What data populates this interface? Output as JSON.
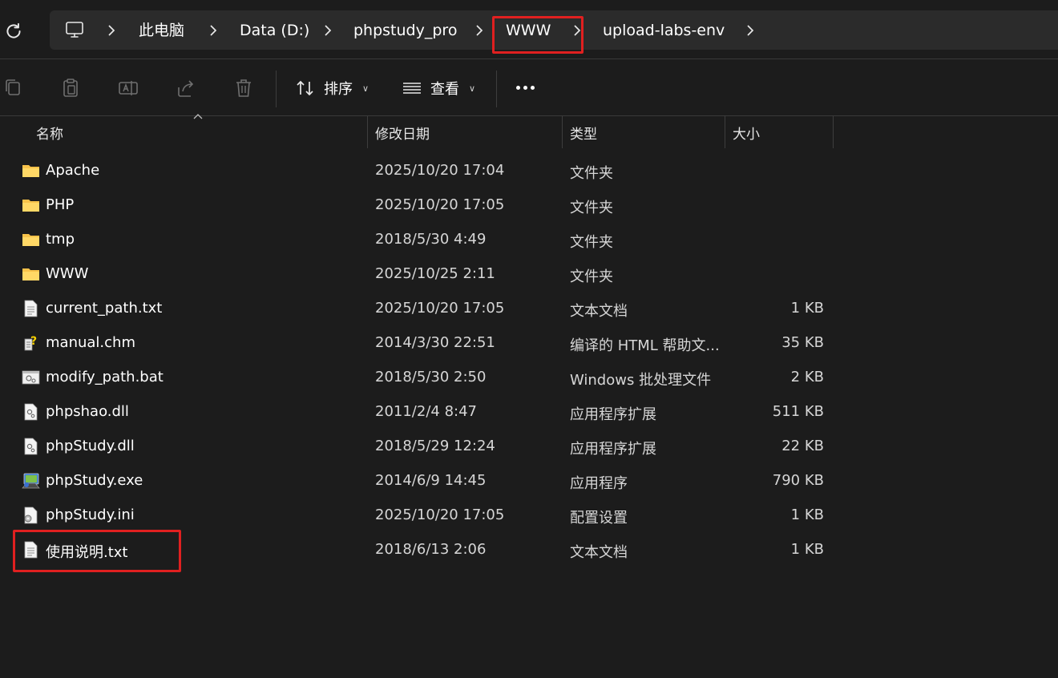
{
  "breadcrumb": {
    "items": [
      "此电脑",
      "Data (D:)",
      "phpstudy_pro",
      "WWW",
      "upload-labs-env"
    ]
  },
  "toolbar": {
    "sort_label": "排序",
    "view_label": "查看"
  },
  "columns": {
    "name": "名称",
    "date": "修改日期",
    "type": "类型",
    "size": "大小"
  },
  "files": [
    {
      "name": "Apache",
      "date": "2025/10/20 17:04",
      "type": "文件夹",
      "size": "",
      "icon": "folder-icon"
    },
    {
      "name": "PHP",
      "date": "2025/10/20 17:05",
      "type": "文件夹",
      "size": "",
      "icon": "folder-icon"
    },
    {
      "name": "tmp",
      "date": "2018/5/30 4:49",
      "type": "文件夹",
      "size": "",
      "icon": "folder-icon"
    },
    {
      "name": "WWW",
      "date": "2025/10/25 2:11",
      "type": "文件夹",
      "size": "",
      "icon": "folder-icon"
    },
    {
      "name": "current_path.txt",
      "date": "2025/10/20 17:05",
      "type": "文本文档",
      "size": "1 KB",
      "icon": "text-file-icon"
    },
    {
      "name": "manual.chm",
      "date": "2014/3/30 22:51",
      "type": "编译的 HTML 帮助文...",
      "size": "35 KB",
      "icon": "help-file-icon"
    },
    {
      "name": "modify_path.bat",
      "date": "2018/5/30 2:50",
      "type": "Windows 批处理文件",
      "size": "2 KB",
      "icon": "batch-file-icon"
    },
    {
      "name": "phpshao.dll",
      "date": "2011/2/4 8:47",
      "type": "应用程序扩展",
      "size": "511 KB",
      "icon": "dll-file-icon"
    },
    {
      "name": "phpStudy.dll",
      "date": "2018/5/29 12:24",
      "type": "应用程序扩展",
      "size": "22 KB",
      "icon": "dll-file-icon"
    },
    {
      "name": "phpStudy.exe",
      "date": "2014/6/9 14:45",
      "type": "应用程序",
      "size": "790 KB",
      "icon": "exe-file-icon"
    },
    {
      "name": "phpStudy.ini",
      "date": "2025/10/20 17:05",
      "type": "配置设置",
      "size": "1 KB",
      "icon": "ini-file-icon"
    },
    {
      "name": "使用说明.txt",
      "date": "2018/6/13 2:06",
      "type": "文本文档",
      "size": "1 KB",
      "icon": "text-file-icon"
    }
  ],
  "colors": {
    "background": "#1c1c1c",
    "address_bar": "#2b2b2b",
    "highlight": "#e02020",
    "folder": "#f7c24a"
  }
}
